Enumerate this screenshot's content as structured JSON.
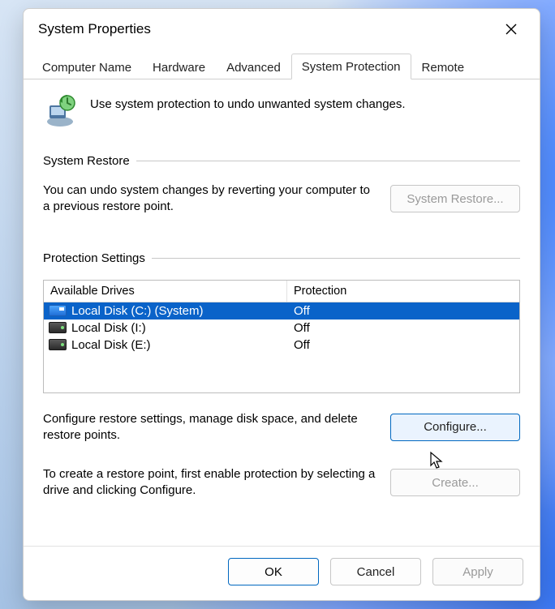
{
  "window": {
    "title": "System Properties"
  },
  "tabs": [
    {
      "label": "Computer Name"
    },
    {
      "label": "Hardware"
    },
    {
      "label": "Advanced"
    },
    {
      "label": "System Protection"
    },
    {
      "label": "Remote"
    }
  ],
  "active_tab_index": 3,
  "intro": {
    "text": "Use system protection to undo unwanted system changes."
  },
  "restore": {
    "group_label": "System Restore",
    "desc": "You can undo system changes by reverting your computer to a previous restore point.",
    "button": "System Restore...",
    "button_enabled": false
  },
  "protection": {
    "group_label": "Protection Settings",
    "columns": {
      "drive": "Available Drives",
      "protection": "Protection"
    },
    "drives": [
      {
        "name": "Local Disk (C:) (System)",
        "protection": "Off",
        "selected": true,
        "icon_kind": "win"
      },
      {
        "name": "Local Disk (I:)",
        "protection": "Off",
        "selected": false,
        "icon_kind": "hdd"
      },
      {
        "name": "Local Disk (E:)",
        "protection": "Off",
        "selected": false,
        "icon_kind": "hdd"
      }
    ],
    "configure_desc": "Configure restore settings, manage disk space, and delete restore points.",
    "configure_button": "Configure...",
    "create_desc": "To create a restore point, first enable protection by selecting a drive and clicking Configure.",
    "create_button": "Create...",
    "create_enabled": false
  },
  "footer": {
    "ok": "OK",
    "cancel": "Cancel",
    "apply": "Apply",
    "apply_enabled": false
  }
}
